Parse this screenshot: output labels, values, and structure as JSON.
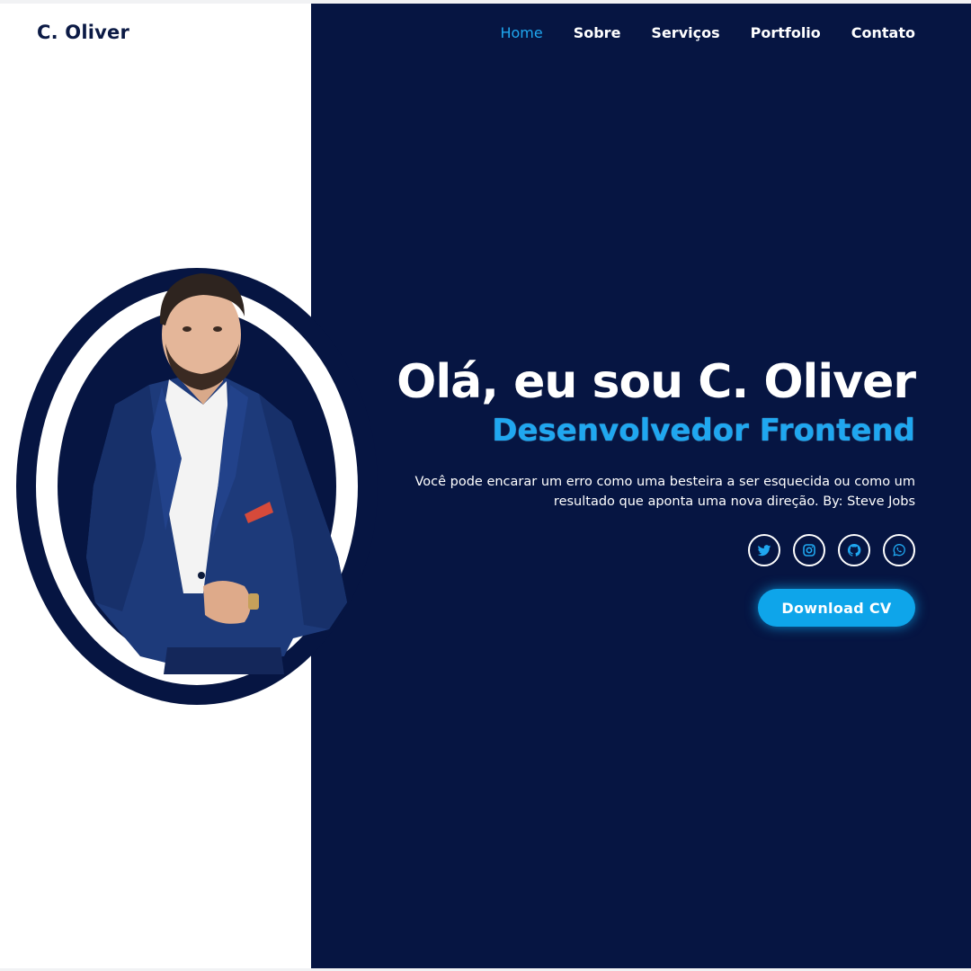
{
  "brand": {
    "logo": "C. Oliver"
  },
  "nav": {
    "items": [
      {
        "label": "Home",
        "active": true
      },
      {
        "label": "Sobre",
        "active": false
      },
      {
        "label": "Serviços",
        "active": false
      },
      {
        "label": "Portfolio",
        "active": false
      },
      {
        "label": "Contato",
        "active": false
      }
    ]
  },
  "hero": {
    "title": "Olá, eu sou C. Oliver",
    "subtitle": "Desenvolvedor Frontend",
    "quote": "Você pode encarar um erro como uma besteira a ser esquecida ou como um resultado que aponta uma nova direção. By: Steve Jobs",
    "cv_button": "Download CV"
  },
  "socials": [
    {
      "icon": "twitter-icon"
    },
    {
      "icon": "instagram-icon"
    },
    {
      "icon": "github-icon"
    },
    {
      "icon": "whatsapp-icon"
    }
  ],
  "colors": {
    "navy": "#061542",
    "accent": "#1fa7f0",
    "button": "#0ea5ea",
    "white": "#ffffff"
  }
}
